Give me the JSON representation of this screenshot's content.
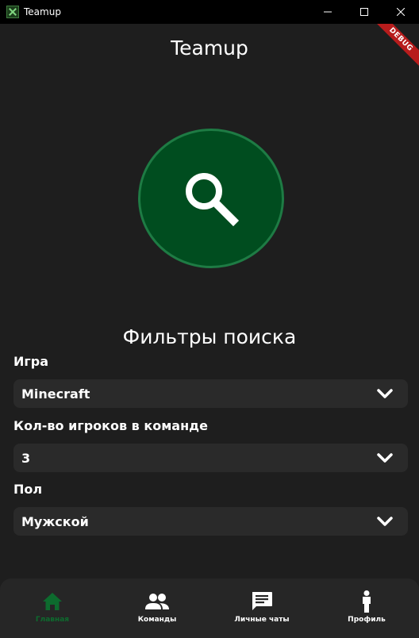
{
  "window": {
    "title": "Teamup",
    "debug_label": "DEBUG"
  },
  "header": {
    "title": "Teamup"
  },
  "filters": {
    "title": "Фильтры поиска",
    "game": {
      "label": "Игра",
      "value": "Minecraft"
    },
    "players": {
      "label": "Кол-во игроков в команде",
      "value": "3"
    },
    "gender": {
      "label": "Пол",
      "value": "Мужской"
    }
  },
  "nav": {
    "items": [
      {
        "label": "Главная",
        "icon": "home-icon",
        "active": true
      },
      {
        "label": "Команды",
        "icon": "group-icon",
        "active": false
      },
      {
        "label": "Личные чаты",
        "icon": "chat-icon",
        "active": false
      },
      {
        "label": "Профиль",
        "icon": "person-icon",
        "active": false
      }
    ]
  },
  "colors": {
    "background": "#1e1e1e",
    "accent": "#004d1f",
    "accent_border": "#1e7b44",
    "active_nav": "#0d6b2e",
    "field_bg": "#2a2a2a"
  }
}
